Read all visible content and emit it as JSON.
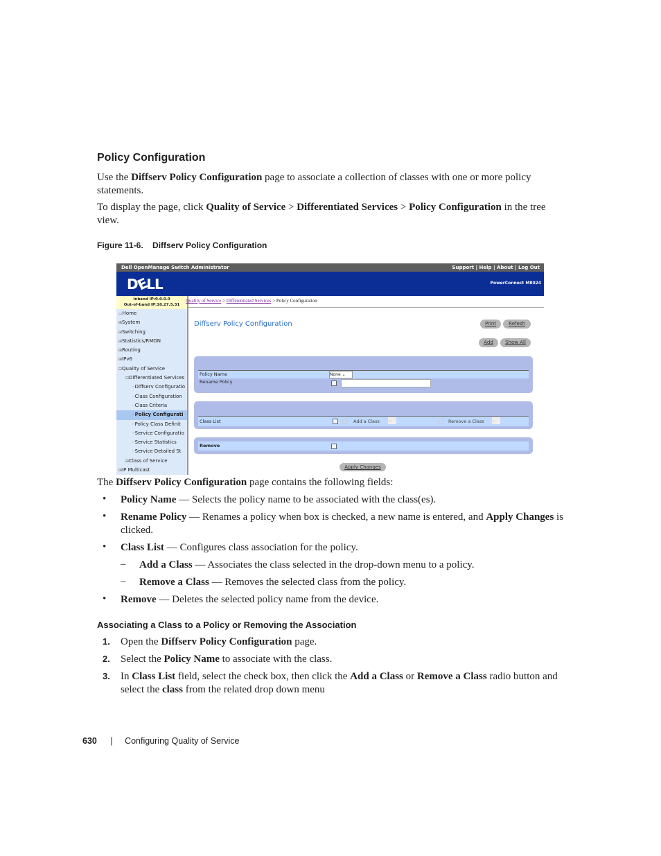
{
  "heading": "Policy Configuration",
  "intro": {
    "pre": "Use the ",
    "b1": "Diffserv Policy Configuration",
    "post": " page to associate a collection of classes with one or more policy statements."
  },
  "nav": {
    "pre": "To display the page, click ",
    "b1": "Quality of Service",
    "sep1": " > ",
    "b2": "Differentiated Services",
    "sep2": " > ",
    "b3": "Policy Configuration",
    "post": " in the tree view."
  },
  "figure_caption": "Figure 11-6.    Diffserv Policy Configuration",
  "screenshot": {
    "title": "Dell OpenManage Switch Administrator",
    "top_links": [
      "Support",
      "Help",
      "About",
      "Log Out"
    ],
    "logo": "DELL",
    "model": "PowerConnect M8024",
    "inband": "Inband IP:0.0.0.0",
    "outband": "Out-of-band IP:10.27.5.31",
    "breadcrumb": {
      "l1": "Quality of Service",
      "l2": "Differentiated Services",
      "current": "Policy Configuration",
      "sep": " > "
    },
    "tree": [
      "Home",
      "System",
      "Switching",
      "Statistics/RMON",
      "Routing",
      "IPv6",
      "Quality of Service",
      "Differentiated Services",
      "Diffserv Configuratio",
      "Class Configuration",
      "Class Criteria",
      "Policy Configurati",
      "Policy Class Definit",
      "Service Configuratio",
      "Service Statistics",
      "Service Detailed St",
      "Class of Service",
      "IP Multicast"
    ],
    "page_title": "Diffserv Policy Configuration",
    "buttons": {
      "print": "Print",
      "refresh": "Refesh",
      "add": "Add",
      "show_all": "Show All",
      "apply": "Apply Changes"
    },
    "policy_name_label": "Policy Name",
    "policy_name_value": "None",
    "rename_label": "Rename Policy",
    "class_list_label": "Class List",
    "add_class": "Add a Class",
    "remove_class": "Remove a Class",
    "remove_label": "Remove"
  },
  "fields_intro": {
    "pre": "The ",
    "b1": "Diffserv Policy Configuration",
    "post": " page contains the following fields:"
  },
  "fields": [
    {
      "term": "Policy Name",
      "desc": " — Selects the policy name to be associated with the class(es)."
    },
    {
      "term": "Rename Policy",
      "desc": " — Renames a policy when box is checked, a new name is entered, and ",
      "b2": "Apply Changes",
      "post": " is clicked."
    },
    {
      "term": "Class List",
      "desc": " — Configures class association for the policy."
    },
    {
      "term": "Add a Class",
      "desc": " — Associates the class selected in the drop-down menu to a policy."
    },
    {
      "term": "Remove a Class",
      "desc": " — Removes the selected class from the policy."
    },
    {
      "term": "Remove",
      "desc": " — Deletes the selected policy name from the device."
    }
  ],
  "subheading": "Associating a Class to a Policy or Removing the Association",
  "steps": [
    {
      "n": "1.",
      "pre": "Open the ",
      "b1": "Diffserv Policy Configuration",
      "post": " page."
    },
    {
      "n": "2.",
      "pre": "Select the ",
      "b1": "Policy Name",
      "post": " to associate with the class."
    },
    {
      "n": "3.",
      "pre": "In ",
      "b1": "Class List",
      "mid": " field, select the check box, then click the ",
      "b2": "Add a Class",
      "mid2": " or ",
      "b3": "Remove a Class",
      "mid3": " radio button and select the ",
      "b4": "class",
      "post": " from the related drop down menu"
    }
  ],
  "footer": {
    "page": "630",
    "sep": "|",
    "section": "Configuring Quality of Service"
  }
}
